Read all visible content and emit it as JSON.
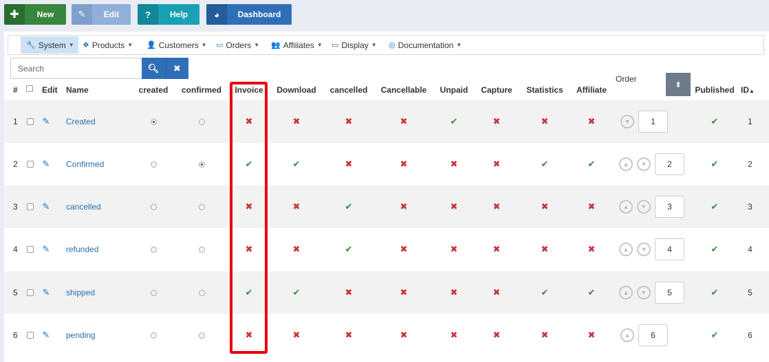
{
  "toolbar": {
    "new_label": "New",
    "edit_label": "Edit",
    "help_label": "Help",
    "dashboard_label": "Dashboard"
  },
  "menu": [
    {
      "label": "System",
      "icon": "wrench-icon",
      "active": true
    },
    {
      "label": "Products",
      "icon": "cubes-icon",
      "active": false
    },
    {
      "label": "Customers",
      "icon": "user-icon",
      "active": false
    },
    {
      "label": "Orders",
      "icon": "credit-card-icon",
      "active": false
    },
    {
      "label": "Affiliates",
      "icon": "user-plus-icon",
      "active": false
    },
    {
      "label": "Display",
      "icon": "monitor-icon",
      "active": false
    },
    {
      "label": "Documentation",
      "icon": "lifebuoy-icon",
      "active": false
    }
  ],
  "search": {
    "placeholder": "Search"
  },
  "columns": {
    "num": "#",
    "edit": "Edit",
    "name": "Name",
    "created": "created",
    "confirmed": "confirmed",
    "invoice": "Invoice",
    "download": "Download",
    "cancelled": "cancelled",
    "cancellable": "Cancellable",
    "unpaid": "Unpaid",
    "capture": "Capture",
    "statistics": "Statistics",
    "affiliate": "Affiliate",
    "order": "Order",
    "published": "Published",
    "id": "ID"
  },
  "colors": {
    "yes": "#3a8a3d",
    "no": "#c8333b",
    "highlight": "#e8000b",
    "link": "#2a6fb1"
  },
  "rows": [
    {
      "num": "1",
      "name": "Created",
      "created": true,
      "confirmed": false,
      "invoice": false,
      "download": false,
      "cancelled": false,
      "cancellable": false,
      "unpaid": true,
      "capture": false,
      "statistics": false,
      "affiliate": false,
      "order": "1",
      "up": false,
      "down": true,
      "published": true,
      "id": "1"
    },
    {
      "num": "2",
      "name": "Confirmed",
      "created": false,
      "confirmed": true,
      "invoice": true,
      "download": true,
      "cancelled": false,
      "cancellable": false,
      "unpaid": false,
      "capture": false,
      "statistics": true,
      "affiliate": true,
      "order": "2",
      "up": true,
      "down": true,
      "published": true,
      "id": "2"
    },
    {
      "num": "3",
      "name": "cancelled",
      "created": false,
      "confirmed": false,
      "invoice": false,
      "download": false,
      "cancelled": true,
      "cancellable": false,
      "unpaid": false,
      "capture": false,
      "statistics": false,
      "affiliate": false,
      "order": "3",
      "up": true,
      "down": true,
      "published": true,
      "id": "3"
    },
    {
      "num": "4",
      "name": "refunded",
      "created": false,
      "confirmed": false,
      "invoice": false,
      "download": false,
      "cancelled": true,
      "cancellable": false,
      "unpaid": false,
      "capture": false,
      "statistics": false,
      "affiliate": false,
      "order": "4",
      "up": true,
      "down": true,
      "published": true,
      "id": "4"
    },
    {
      "num": "5",
      "name": "shipped",
      "created": false,
      "confirmed": false,
      "invoice": true,
      "download": true,
      "cancelled": false,
      "cancellable": false,
      "unpaid": false,
      "capture": false,
      "statistics": true,
      "affiliate": true,
      "order": "5",
      "up": true,
      "down": true,
      "published": true,
      "id": "5"
    },
    {
      "num": "6",
      "name": "pending",
      "created": false,
      "confirmed": false,
      "invoice": false,
      "download": false,
      "cancelled": false,
      "cancellable": false,
      "unpaid": false,
      "capture": false,
      "statistics": false,
      "affiliate": false,
      "order": "6",
      "up": true,
      "down": false,
      "published": true,
      "id": "6"
    }
  ]
}
